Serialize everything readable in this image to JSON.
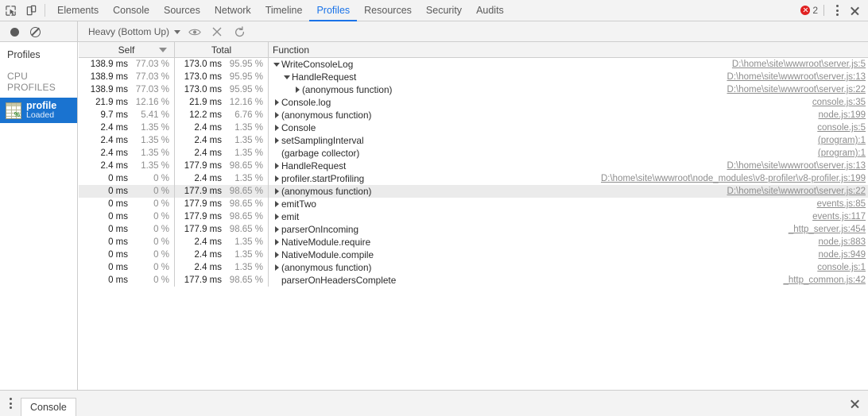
{
  "window": {
    "devtools_tabs": [
      {
        "label": "Elements",
        "active": false
      },
      {
        "label": "Console",
        "active": false
      },
      {
        "label": "Sources",
        "active": false
      },
      {
        "label": "Network",
        "active": false
      },
      {
        "label": "Timeline",
        "active": false
      },
      {
        "label": "Profiles",
        "active": true
      },
      {
        "label": "Resources",
        "active": false
      },
      {
        "label": "Security",
        "active": false
      },
      {
        "label": "Audits",
        "active": false
      }
    ],
    "inspect_icon": "inspect-element-icon",
    "device_icon": "toggle-device-toolbar-icon",
    "error_count": "2",
    "more_icon": "kebab-menu-icon",
    "close_icon": "close-icon"
  },
  "panel_toolbar": {
    "record_icon": "record-circle-icon",
    "clear_icon": "clear-no-entry-icon",
    "view_mode": "Heavy (Bottom Up)",
    "view_caret": "chevron-down-icon",
    "focus_icon": "eye-focus-icon",
    "exclude_icon": "exclude-x-icon",
    "restore_icon": "restore-refresh-icon"
  },
  "sidebar": {
    "title": "Profiles",
    "section_label": "CPU PROFILES",
    "items": [
      {
        "name": "profile",
        "status": "Loaded",
        "icon": "cpu-profile-icon",
        "selected": true,
        "accent": "#1a73d0"
      }
    ]
  },
  "grid": {
    "columns": [
      {
        "key": "self",
        "label": "Self",
        "sorted": true,
        "sort_dir": "desc"
      },
      {
        "key": "total",
        "label": "Total",
        "sorted": false,
        "sort_dir": ""
      },
      {
        "key": "func",
        "label": "Function",
        "sorted": false,
        "sort_dir": ""
      }
    ],
    "rows": [
      {
        "self_ms": "138.9 ms",
        "self_pct": "77.03 %",
        "total_ms": "173.0 ms",
        "total_pct": "95.95 %",
        "depth": 0,
        "tri": "down",
        "name": "WriteConsoleLog",
        "url": "D:\\home\\site\\wwwroot\\server.js:5",
        "highlight": false
      },
      {
        "self_ms": "138.9 ms",
        "self_pct": "77.03 %",
        "total_ms": "173.0 ms",
        "total_pct": "95.95 %",
        "depth": 1,
        "tri": "down",
        "name": "HandleRequest",
        "url": "D:\\home\\site\\wwwroot\\server.js:13",
        "highlight": false
      },
      {
        "self_ms": "138.9 ms",
        "self_pct": "77.03 %",
        "total_ms": "173.0 ms",
        "total_pct": "95.95 %",
        "depth": 2,
        "tri": "right",
        "name": "(anonymous function)",
        "url": "D:\\home\\site\\wwwroot\\server.js:22",
        "highlight": false
      },
      {
        "self_ms": "21.9 ms",
        "self_pct": "12.16 %",
        "total_ms": "21.9 ms",
        "total_pct": "12.16 %",
        "depth": 0,
        "tri": "right",
        "name": "Console.log",
        "url": "console.js:35",
        "highlight": false
      },
      {
        "self_ms": "9.7 ms",
        "self_pct": "5.41 %",
        "total_ms": "12.2 ms",
        "total_pct": "6.76 %",
        "depth": 0,
        "tri": "right",
        "name": "(anonymous function)",
        "url": "node.js:199",
        "highlight": false
      },
      {
        "self_ms": "2.4 ms",
        "self_pct": "1.35 %",
        "total_ms": "2.4 ms",
        "total_pct": "1.35 %",
        "depth": 0,
        "tri": "right",
        "name": "Console",
        "url": "console.js:5",
        "highlight": false
      },
      {
        "self_ms": "2.4 ms",
        "self_pct": "1.35 %",
        "total_ms": "2.4 ms",
        "total_pct": "1.35 %",
        "depth": 0,
        "tri": "right",
        "name": "setSamplingInterval",
        "url": "(program):1",
        "highlight": false
      },
      {
        "self_ms": "2.4 ms",
        "self_pct": "1.35 %",
        "total_ms": "2.4 ms",
        "total_pct": "1.35 %",
        "depth": 0,
        "tri": "none",
        "name": "(garbage collector)",
        "url": "(program):1",
        "highlight": false
      },
      {
        "self_ms": "2.4 ms",
        "self_pct": "1.35 %",
        "total_ms": "177.9 ms",
        "total_pct": "98.65 %",
        "depth": 0,
        "tri": "right",
        "name": "HandleRequest",
        "url": "D:\\home\\site\\wwwroot\\server.js:13",
        "highlight": false
      },
      {
        "self_ms": "0 ms",
        "self_pct": "0 %",
        "total_ms": "2.4 ms",
        "total_pct": "1.35 %",
        "depth": 0,
        "tri": "right",
        "name": "profiler.startProfiling",
        "url": "D:\\home\\site\\wwwroot\\node_modules\\v8-profiler\\v8-profiler.js:199",
        "highlight": false
      },
      {
        "self_ms": "0 ms",
        "self_pct": "0 %",
        "total_ms": "177.9 ms",
        "total_pct": "98.65 %",
        "depth": 0,
        "tri": "right",
        "name": "(anonymous function)",
        "url": "D:\\home\\site\\wwwroot\\server.js:22",
        "highlight": true
      },
      {
        "self_ms": "0 ms",
        "self_pct": "0 %",
        "total_ms": "177.9 ms",
        "total_pct": "98.65 %",
        "depth": 0,
        "tri": "right",
        "name": "emitTwo",
        "url": "events.js:85",
        "highlight": false
      },
      {
        "self_ms": "0 ms",
        "self_pct": "0 %",
        "total_ms": "177.9 ms",
        "total_pct": "98.65 %",
        "depth": 0,
        "tri": "right",
        "name": "emit",
        "url": "events.js:117",
        "highlight": false
      },
      {
        "self_ms": "0 ms",
        "self_pct": "0 %",
        "total_ms": "177.9 ms",
        "total_pct": "98.65 %",
        "depth": 0,
        "tri": "right",
        "name": "parserOnIncoming",
        "url": "_http_server.js:454",
        "highlight": false
      },
      {
        "self_ms": "0 ms",
        "self_pct": "0 %",
        "total_ms": "2.4 ms",
        "total_pct": "1.35 %",
        "depth": 0,
        "tri": "right",
        "name": "NativeModule.require",
        "url": "node.js:883",
        "highlight": false
      },
      {
        "self_ms": "0 ms",
        "self_pct": "0 %",
        "total_ms": "2.4 ms",
        "total_pct": "1.35 %",
        "depth": 0,
        "tri": "right",
        "name": "NativeModule.compile",
        "url": "node.js:949",
        "highlight": false
      },
      {
        "self_ms": "0 ms",
        "self_pct": "0 %",
        "total_ms": "2.4 ms",
        "total_pct": "1.35 %",
        "depth": 0,
        "tri": "right",
        "name": "(anonymous function)",
        "url": "console.js:1",
        "highlight": false
      },
      {
        "self_ms": "0 ms",
        "self_pct": "0 %",
        "total_ms": "177.9 ms",
        "total_pct": "98.65 %",
        "depth": 0,
        "tri": "none",
        "name": "parserOnHeadersComplete",
        "url": "_http_common.js:42",
        "highlight": false
      }
    ]
  },
  "drawer": {
    "more_icon": "kebab-menu-icon",
    "tabs": [
      {
        "label": "Console",
        "active": true
      }
    ],
    "close_icon": "close-icon"
  },
  "colors": {
    "accent": "#1a73e8",
    "selection": "#1a73d0",
    "error": "#e02020",
    "toolbar_bg": "#f3f3f3",
    "border": "#cdcdcd",
    "muted_text": "#8d8d8d"
  }
}
